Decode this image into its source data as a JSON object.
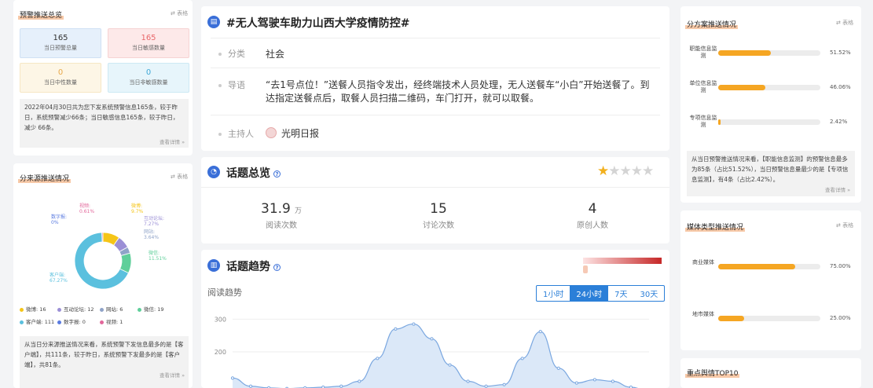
{
  "warning": {
    "title": "预警推送总览",
    "table_toggle": "⇄ 表格",
    "boxes": [
      {
        "value": "165",
        "label": "当日预警总量"
      },
      {
        "value": "165",
        "label": "当日敏感数量"
      },
      {
        "value": "0",
        "label": "当日中性数量"
      },
      {
        "value": "0",
        "label": "当日非敏感数量"
      }
    ],
    "summary": "2022年04月30日共为您下发系统预警信息165条，较于昨日，系统预警减少66条；当日敏感信息165条，较于昨日，减少 66条。",
    "detail_link": "查看详情 »"
  },
  "source": {
    "title": "分来源推送情况",
    "table_toggle": "⇄ 表格",
    "slice_labels": [
      {
        "name": "微博:",
        "pct": "9.7%"
      },
      {
        "name": "互动论坛:",
        "pct": "7.27%"
      },
      {
        "name": "网站:",
        "pct": "3.64%"
      },
      {
        "name": "微信:",
        "pct": "11.51%"
      },
      {
        "name": "客户端:",
        "pct": "67.27%"
      },
      {
        "name": "数字报:",
        "pct": "0%"
      },
      {
        "name": "视频:",
        "pct": "0.61%"
      }
    ],
    "legend": [
      {
        "label": "微博: 16",
        "color": "#f5c518"
      },
      {
        "label": "互动论坛: 12",
        "color": "#9b8fd6"
      },
      {
        "label": "网站: 6",
        "color": "#8fa3c8"
      },
      {
        "label": "微信: 19",
        "color": "#5fcf9a"
      },
      {
        "label": "客户端: 111",
        "color": "#5bc0de"
      },
      {
        "label": "数字报: 0",
        "color": "#5a7be0"
      },
      {
        "label": "视频: 1",
        "color": "#e2679b"
      }
    ],
    "summary": "从当日分来源推送情况来看，系统预警下发信息最多的是【客户端】，共111条，较于昨日，系统预警下发最多的是【客户端】，共81条。",
    "detail_link": "查看详情 »"
  },
  "topic": {
    "title": "#无人驾驶车助力山西大学疫情防控#",
    "category_label": "分类",
    "category_value": "社会",
    "lead_label": "导语",
    "lead_value": "“去1号点位！”送餐人员指令发出，经终端技术人员处理，无人送餐车“小白”开始送餐了。到达指定送餐点后，取餐人员扫描二维码，车门打开，就可以取餐。",
    "host_label": "主持人",
    "host_value": "光明日报"
  },
  "overview": {
    "title": "话题总览",
    "rating": 1,
    "stats": [
      {
        "value": "31.9",
        "unit": "万",
        "label": "阅读次数"
      },
      {
        "value": "15",
        "unit": "",
        "label": "讨论次数"
      },
      {
        "value": "4",
        "unit": "",
        "label": "原创人数"
      }
    ]
  },
  "trend": {
    "title": "话题趋势",
    "subtitle": "阅读趋势",
    "tabs": [
      "1小时",
      "24小时",
      "7天",
      "30天"
    ],
    "active_tab": "24小时",
    "y_ticks": [
      "300",
      "200"
    ]
  },
  "chart_data": {
    "type": "area",
    "yticks": [
      300,
      200
    ],
    "ylim": [
      80,
      320
    ],
    "values": [
      120,
      95,
      90,
      88,
      90,
      92,
      95,
      110,
      180,
      270,
      285,
      240,
      160,
      110,
      95,
      100,
      180,
      262,
      150,
      105,
      115,
      110,
      92,
      80
    ]
  },
  "plan": {
    "title": "分方案推送情况",
    "table_toggle": "⇄ 表格",
    "bars": [
      {
        "label": "职能信息监测",
        "pct": "51.52%",
        "value": 0.5152
      },
      {
        "label": "单位信息监测",
        "pct": "46.06%",
        "value": 0.4606
      },
      {
        "label": "专项信息监测",
        "pct": "2.42%",
        "value": 0.0242
      }
    ],
    "summary": "从当日预警推送情况来看，【职能信息监测】的预警信息最多为85条（占比51.52%），当日预警信息量最少的是【专项信息监测】，有4条（占比2.42%）。",
    "detail_link": "查看详情 »"
  },
  "media": {
    "title": "媒体类型推送情况",
    "table_toggle": "⇄ 表格",
    "bars": [
      {
        "label": "商业媒体",
        "pct": "75.00%",
        "value": 0.75
      },
      {
        "label": "地市媒体",
        "pct": "25.00%",
        "value": 0.25
      }
    ]
  },
  "top10": {
    "title": "重点舆情TOP10"
  }
}
